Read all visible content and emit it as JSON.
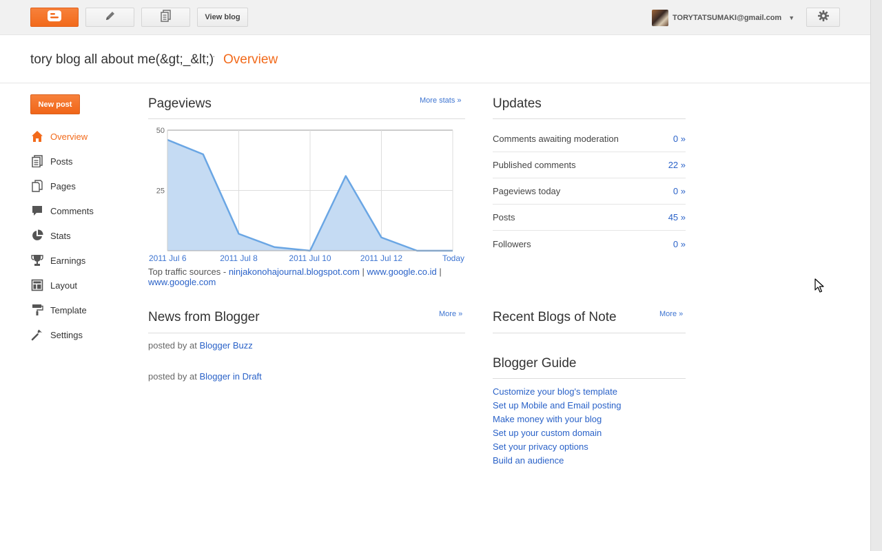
{
  "topbar": {
    "view_blog_label": "View blog",
    "account_email": "TORYTATSUMAKI@gmail.com",
    "icons": {
      "logo": "blogger-logo-icon",
      "edit": "pencil-icon",
      "posts": "posts-list-icon",
      "settings": "gear-icon",
      "account_menu": "chevron-down-icon"
    }
  },
  "header": {
    "blog_title": "tory blog all about me(&gt;_&lt;)",
    "separator": "·",
    "current_page": "Overview"
  },
  "sidebar": {
    "new_post_label": "New post",
    "items": [
      {
        "label": "Overview",
        "icon": "home-icon",
        "active": true
      },
      {
        "label": "Posts",
        "icon": "posts-icon"
      },
      {
        "label": "Pages",
        "icon": "pages-icon"
      },
      {
        "label": "Comments",
        "icon": "comment-icon"
      },
      {
        "label": "Stats",
        "icon": "pie-chart-icon"
      },
      {
        "label": "Earnings",
        "icon": "trophy-icon"
      },
      {
        "label": "Layout",
        "icon": "layout-icon"
      },
      {
        "label": "Template",
        "icon": "paint-roller-icon"
      },
      {
        "label": "Settings",
        "icon": "wrench-icon"
      }
    ]
  },
  "pageviews": {
    "title": "Pageviews",
    "more_label": "More stats »",
    "traffic_prefix": "Top traffic sources -",
    "sources": [
      "ninjakonohajournal.blogspot.com",
      "www.google.co.id",
      "www.google.com"
    ],
    "source_separator": "|"
  },
  "chart_data": {
    "type": "area",
    "x": [
      "2011 Jul 6",
      "2011 Jul 7",
      "2011 Jul 8",
      "2011 Jul 9",
      "2011 Jul 10",
      "2011 Jul 11",
      "2011 Jul 12",
      "2011 Jul 13",
      "Today"
    ],
    "tick_labels": [
      "2011 Jul 6",
      "2011 Jul 8",
      "2011 Jul 10",
      "2011 Jul 12",
      "Today"
    ],
    "tick_indices": [
      0,
      2,
      4,
      6,
      8
    ],
    "values": [
      46,
      40,
      7,
      1.5,
      0,
      31,
      5.5,
      0,
      0
    ],
    "y_ticks": [
      "50",
      "25"
    ],
    "ylim": [
      0,
      50
    ],
    "fill_color": "#c5dbf3",
    "line_color": "#6aa6e4",
    "grid": true
  },
  "updates": {
    "title": "Updates",
    "rows": [
      {
        "label": "Comments awaiting moderation",
        "value": "0 »"
      },
      {
        "label": "Published comments",
        "value": "22 »"
      },
      {
        "label": "Pageviews today",
        "value": "0 »"
      },
      {
        "label": "Posts",
        "value": "45 »"
      },
      {
        "label": "Followers",
        "value": "0 »"
      }
    ]
  },
  "news": {
    "title": "News from Blogger",
    "more_label": "More »",
    "items": [
      {
        "prefix": "posted by  at",
        "source": "Blogger Buzz"
      },
      {
        "prefix": "posted by  at",
        "source": "Blogger in Draft"
      }
    ]
  },
  "recent_blogs": {
    "title": "Recent Blogs of Note",
    "more_label": "More »"
  },
  "guide": {
    "title": "Blogger Guide",
    "links": [
      "Customize your blog's template",
      "Set up Mobile and Email posting",
      "Make money with your blog",
      "Set up your custom domain",
      "Set your privacy options",
      "Build an audience"
    ]
  },
  "colors": {
    "accent": "#f26a1b",
    "link": "#2a62c8"
  }
}
